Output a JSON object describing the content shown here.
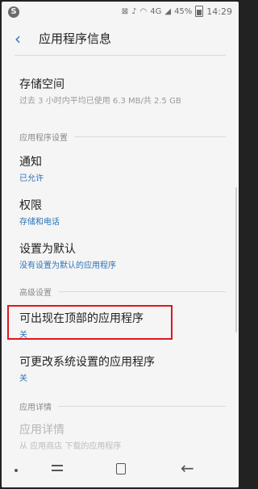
{
  "status_bar": {
    "left_icon": "S",
    "network": "4G",
    "battery_percent": "45%",
    "time": "14:29"
  },
  "header": {
    "title": "应用程序信息"
  },
  "storage": {
    "title": "存储空间",
    "subtitle": "过去 3 小时内平均已使用 6.3 MB/共 2.5 GB"
  },
  "sections": {
    "app_settings": "应用程序设置",
    "advanced": "高级设置",
    "app_details": "应用详情"
  },
  "items": [
    {
      "title": "通知",
      "subtitle": "已允许"
    },
    {
      "title": "权限",
      "subtitle": "存储和电话"
    },
    {
      "title": "设置为默认",
      "subtitle": "没有设置为默认的应用程序"
    },
    {
      "title": "可出现在顶部的应用程序",
      "subtitle": "关"
    },
    {
      "title": "可更改系统设置的应用程序",
      "subtitle": "关"
    },
    {
      "title": "应用详情",
      "subtitle": "从 应用商店 下载的应用程序"
    }
  ],
  "colors": {
    "accent": "#2c74b8",
    "highlight_border": "#e0161c"
  }
}
